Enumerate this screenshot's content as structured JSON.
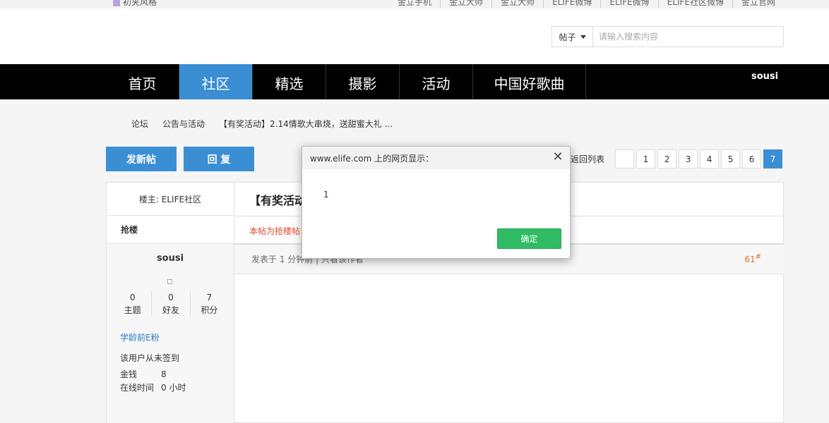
{
  "topbar": {
    "left_label": "初夹风格",
    "links": [
      "金立手机",
      "金立大师",
      "金立大师",
      "ELIFE微博",
      "ELIFE微博",
      "ELIFE社区微博",
      "金立官网"
    ]
  },
  "search": {
    "type_label": "帖子",
    "placeholder": "请输入搜索内容"
  },
  "nav": {
    "items": [
      "首页",
      "社区",
      "精选",
      "摄影",
      "活动",
      "中国好歌曲"
    ],
    "active_index": 1,
    "user": "sousi"
  },
  "breadcrumb": [
    "论坛",
    "公告与活动",
    "【有奖活动】2.14情歌大串烧，送甜蜜大礼 ..."
  ],
  "actions": {
    "new_post": "发新帖",
    "reply": "回 复"
  },
  "pager": {
    "back_label": "返回列表",
    "pages": [
      "",
      "1",
      "2",
      "3",
      "4",
      "5",
      "6",
      "7"
    ],
    "current": "7"
  },
  "thread": {
    "owner_label": "楼主: ELIFE社区",
    "title": "【有奖活动",
    "qianglou_label": "抢楼",
    "note": "本帖为抢楼帖"
  },
  "post": {
    "meta": "发表于 1 分钟前  |  只看该作者",
    "floor": "61",
    "floor_mark": "#"
  },
  "user": {
    "name": "sousi",
    "stats": [
      {
        "value": "0",
        "label": "主题"
      },
      {
        "value": "0",
        "label": "好友"
      },
      {
        "value": "7",
        "label": "积分"
      }
    ],
    "badge": "学龄前E粉",
    "signin": "该用户从未签到",
    "money_label": "金钱",
    "money_value": "8",
    "online_label": "在线时间",
    "online_value": "0 小时"
  },
  "dialog": {
    "title": "www.elife.com 上的网页显示：",
    "message": "1",
    "ok_label": "确定"
  },
  "colors": {
    "accent": "#3a8ed3",
    "ok_button": "#2fbc64",
    "note_red": "#e04a2c"
  }
}
